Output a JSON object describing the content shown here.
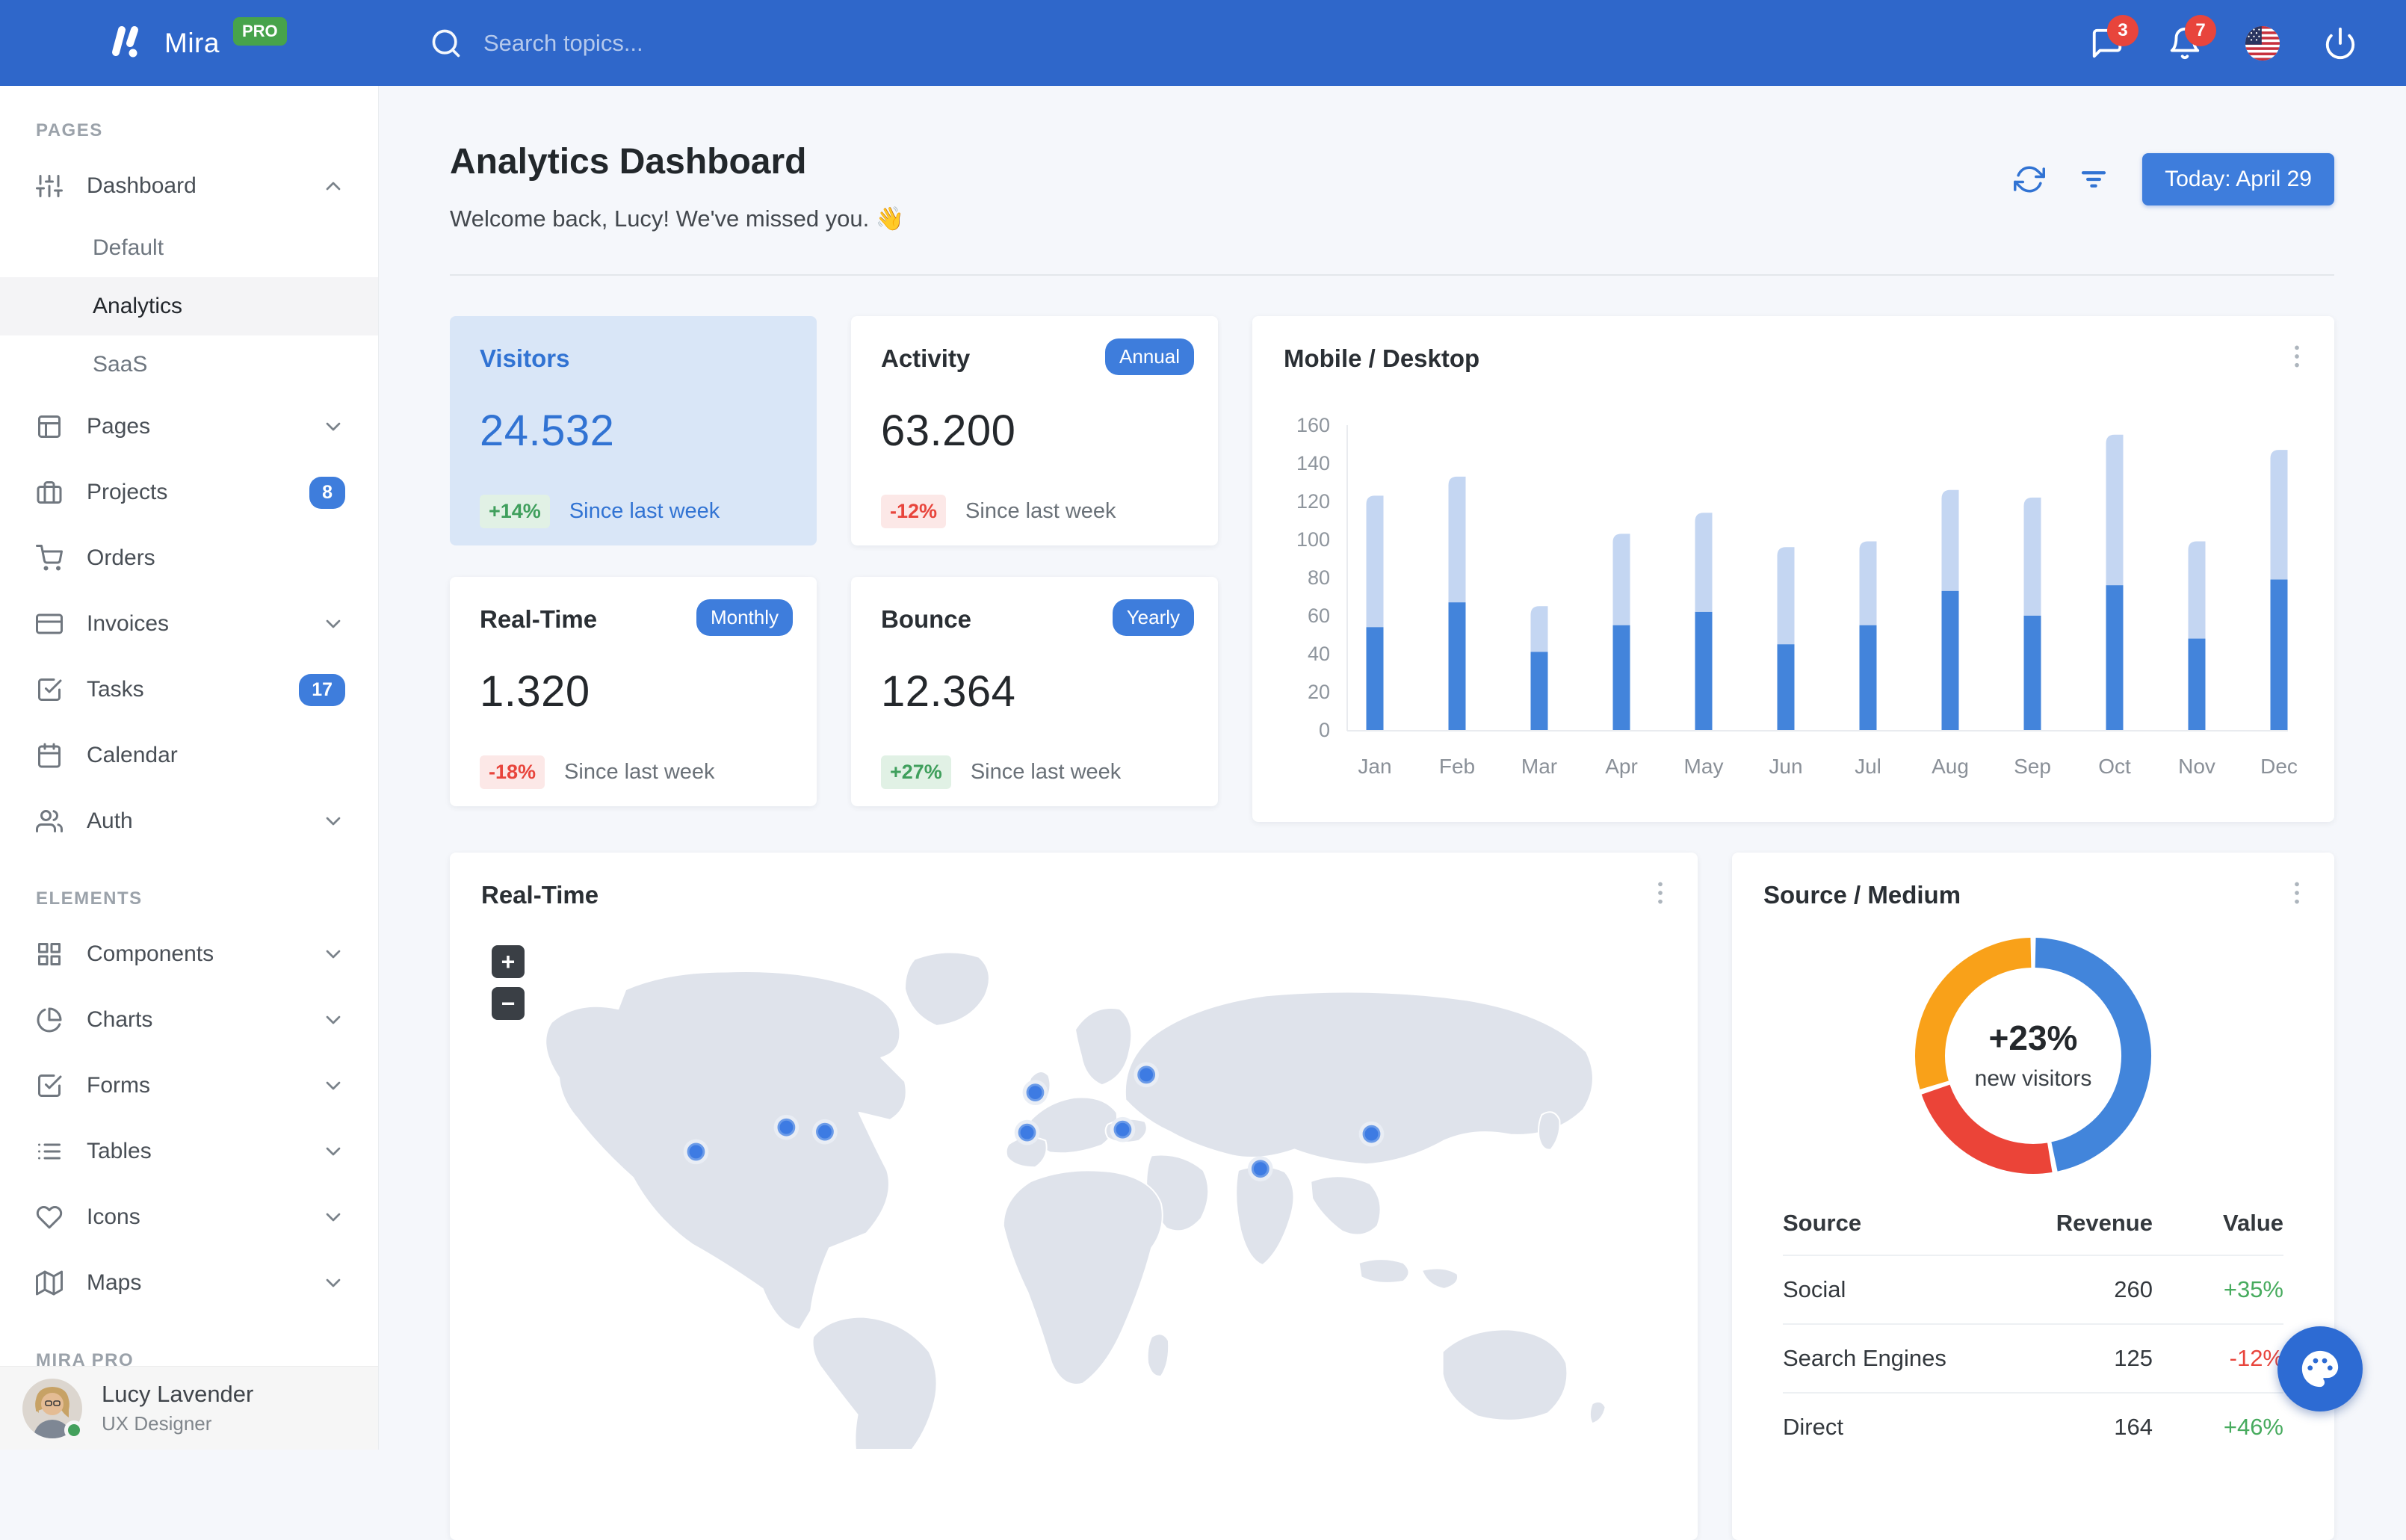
{
  "colors": {
    "navbar": "#2F67CA",
    "primary": "#3E7DDC",
    "success": "#43A45F",
    "danger": "#E8453C",
    "bar_mobile": "#4384DB",
    "bar_desktop": "#C4D6F2",
    "donut_blue": "#4285DB",
    "donut_red": "#EB4438",
    "donut_orange": "#F9A119"
  },
  "navbar": {
    "brand": "Mira",
    "brand_badge": "PRO",
    "search_placeholder": "Search topics...",
    "messages_badge": "3",
    "notifications_badge": "7"
  },
  "sidebar": {
    "sections": [
      {
        "label": "PAGES",
        "items": [
          {
            "icon": "sliders",
            "label": "Dashboard",
            "chevron": "up",
            "children": [
              {
                "label": "Default",
                "active": false
              },
              {
                "label": "Analytics",
                "active": true
              },
              {
                "label": "SaaS",
                "active": false
              }
            ]
          },
          {
            "icon": "layout",
            "label": "Pages",
            "chevron": "down"
          },
          {
            "icon": "briefcase",
            "label": "Projects",
            "badge": "8"
          },
          {
            "icon": "shopping-cart",
            "label": "Orders"
          },
          {
            "icon": "credit-card",
            "label": "Invoices",
            "chevron": "down"
          },
          {
            "icon": "check-square",
            "label": "Tasks",
            "badge": "17"
          },
          {
            "icon": "calendar",
            "label": "Calendar"
          },
          {
            "icon": "users",
            "label": "Auth",
            "chevron": "down"
          }
        ]
      },
      {
        "label": "ELEMENTS",
        "items": [
          {
            "icon": "grid",
            "label": "Components",
            "chevron": "down"
          },
          {
            "icon": "pie-chart",
            "label": "Charts",
            "chevron": "down"
          },
          {
            "icon": "check-square",
            "label": "Forms",
            "chevron": "down"
          },
          {
            "icon": "list",
            "label": "Tables",
            "chevron": "down"
          },
          {
            "icon": "heart",
            "label": "Icons",
            "chevron": "down"
          },
          {
            "icon": "map",
            "label": "Maps",
            "chevron": "down"
          }
        ]
      },
      {
        "label": "MIRA PRO",
        "items": []
      }
    ],
    "user": {
      "name": "Lucy Lavender",
      "role": "UX Designer"
    }
  },
  "header": {
    "title": "Analytics Dashboard",
    "welcome": "Welcome back, Lucy! We've missed you. 👋",
    "date_button": "Today: April 29"
  },
  "stats": [
    {
      "title": "Visitors",
      "value": "24.532",
      "delta": "+14%",
      "delta_dir": "up",
      "note": "Since last week",
      "highlight": true
    },
    {
      "title": "Activity",
      "pill": "Annual",
      "value": "63.200",
      "delta": "-12%",
      "delta_dir": "down",
      "note": "Since last week",
      "highlight": false
    },
    {
      "title": "Real-Time",
      "pill": "Monthly",
      "value": "1.320",
      "delta": "-18%",
      "delta_dir": "down",
      "note": "Since last week",
      "highlight": false
    },
    {
      "title": "Bounce",
      "pill": "Yearly",
      "value": "12.364",
      "delta": "+27%",
      "delta_dir": "up",
      "note": "Since last week",
      "highlight": false
    }
  ],
  "mobile_desktop": {
    "title": "Mobile / Desktop",
    "chart_data": {
      "type": "bar",
      "stacked": true,
      "categories": [
        "Jan",
        "Feb",
        "Mar",
        "Apr",
        "May",
        "Jun",
        "Jul",
        "Aug",
        "Sep",
        "Oct",
        "Nov",
        "Dec"
      ],
      "series": [
        {
          "name": "Mobile",
          "values": [
            54,
            67,
            41,
            55,
            62,
            45,
            55,
            73,
            60,
            76,
            48,
            79
          ]
        },
        {
          "name": "Desktop",
          "values": [
            69,
            66,
            24,
            48,
            52,
            51,
            44,
            53,
            62,
            79,
            51,
            68
          ]
        }
      ],
      "ylim": [
        0,
        160
      ],
      "ytick_step": 20,
      "grid": false,
      "legend": "none"
    }
  },
  "realtime_map": {
    "title": "Real-Time",
    "zoom_in": "+",
    "zoom_out": "−",
    "markers": [
      {
        "x": 290,
        "y": 305
      },
      {
        "x": 412,
        "y": 272
      },
      {
        "x": 464,
        "y": 278
      },
      {
        "x": 748,
        "y": 225
      },
      {
        "x": 737,
        "y": 279
      },
      {
        "x": 898,
        "y": 201
      },
      {
        "x": 866,
        "y": 275
      },
      {
        "x": 1052,
        "y": 328
      },
      {
        "x": 1202,
        "y": 281
      }
    ]
  },
  "source_medium": {
    "title": "Source / Medium",
    "center_value": "+23%",
    "center_label": "new visitors",
    "chart_data": {
      "type": "pie",
      "donut": true,
      "segments": [
        {
          "label": "Social",
          "value": 260,
          "color": "#4285DB"
        },
        {
          "label": "Search Engines",
          "value": 125,
          "color": "#EB4438"
        },
        {
          "label": "Direct",
          "value": 164,
          "color": "#F9A119"
        }
      ]
    },
    "table": {
      "headers": [
        "Source",
        "Revenue",
        "Value"
      ],
      "rows": [
        {
          "source": "Social",
          "revenue": "260",
          "value": "+35%",
          "trend": "up"
        },
        {
          "source": "Search Engines",
          "revenue": "125",
          "value": "-12%",
          "trend": "down"
        },
        {
          "source": "Direct",
          "revenue": "164",
          "value": "+46%",
          "trend": "up"
        }
      ]
    }
  }
}
